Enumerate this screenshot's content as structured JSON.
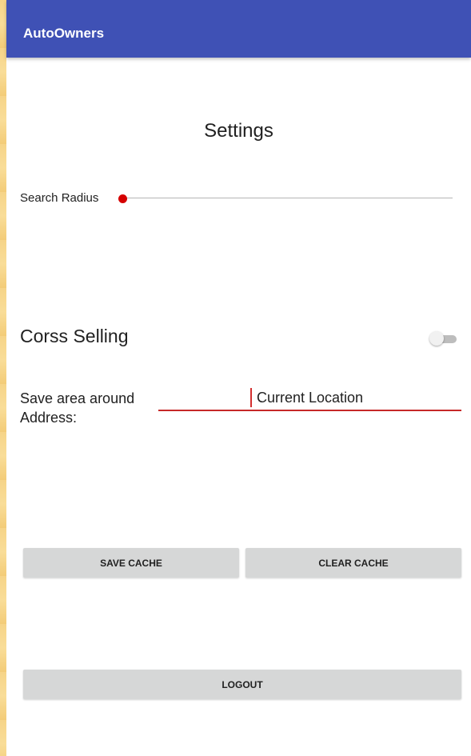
{
  "app_bar": {
    "title": "AutoOwners"
  },
  "settings": {
    "title": "Settings",
    "search_radius": {
      "label": "Search Radius",
      "value_fraction": 0
    },
    "cross_selling": {
      "label": "Corss Selling",
      "enabled": false
    },
    "save_area": {
      "label": "Save area around Address:",
      "value": "Current Location"
    }
  },
  "buttons": {
    "save_cache": "SAVE CACHE",
    "clear_cache": "CLEAR CACHE",
    "logout": "LOGOUT"
  },
  "colors": {
    "app_bar": "#3f51b5",
    "accent": "#d50000",
    "button": "#d6d7d7",
    "underline": "#c62828"
  }
}
